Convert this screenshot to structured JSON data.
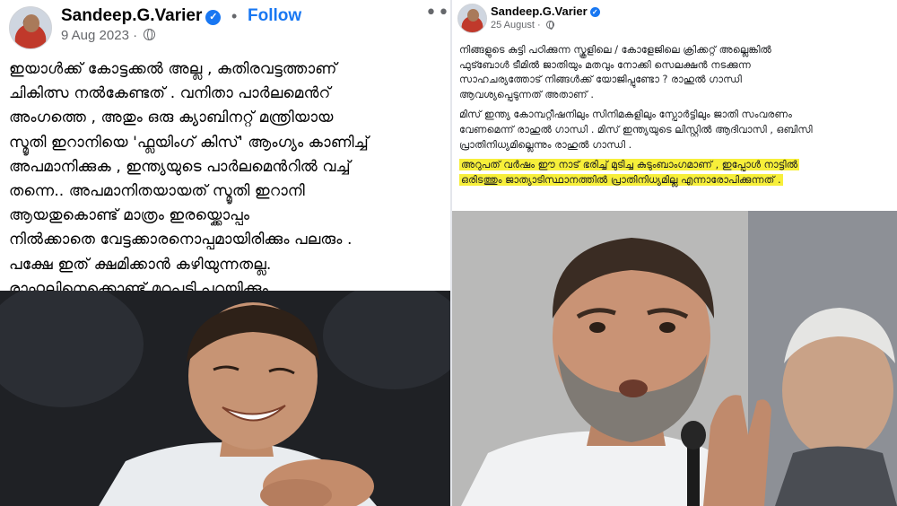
{
  "left_post": {
    "author": "Sandeep.G.Varier",
    "follow_label": "Follow",
    "separator": "•",
    "date": "9 Aug 2023",
    "date_separator": "·",
    "more_icon": "more-horizontal-icon",
    "text_lines": [
      "ഇയാൾക്ക് കോട്ടക്കൽ അല്ല , കുതിരവട്ടത്താണ്",
      "ചികിത്സ നൽകേണ്ടത് .  വനിതാ പാർലമെൻറ്",
      "അംഗത്തെ , അതും ഒരു ക്യാബിനറ്റ് മന്ത്രിയായ",
      "സ്മൃതി ഇറാനിയെ 'ഫ്ലയിംഗ് കിസ്' ആംഗ്യം കാണിച്ച്",
      "അപമാനിക്കുക , ഇന്ത്യയുടെ പാർലമെൻറിൽ വച്ച്",
      "തന്നെ..  അപമാനിതയായത് സ്മൃതി ഇറാനി",
      "ആയതുകൊണ്ട് മാത്രം ഇരയ്ക്കൊപ്പം",
      "നിൽക്കാതെ വേട്ടക്കാരനൊപ്പമായിരിക്കും പലരും .",
      "പക്ഷേ ഇത് ക്ഷമിക്കാൻ കഴിയുന്നതല്ല.",
      "രാഹുലിനെക്കൊണ്ട് മറുപടി പറയിക്കും ."
    ]
  },
  "right_post": {
    "author": "Sandeep.G.Varier",
    "date": "25 August",
    "date_separator": "·",
    "para1_lines": [
      "നിങ്ങളുടെ കുട്ടി പഠിക്കുന്ന സ്കൂളിലെ / കോളേജിലെ  ക്രിക്കറ്റ് അല്ലെങ്കിൽ",
      "ഫുട്ബോൾ ടീമിൽ ജാതിയും മതവും നോക്കി സെലക്ഷൻ നടക്കുന്ന",
      "സാഹചര്യത്തോട് നിങ്ങൾക്ക് യോജിപ്പുണ്ടോ ? രാഹുൽ ഗാന്ധി",
      "ആവശ്യപ്പെടുന്നത് അതാണ് ."
    ],
    "para2_lines": [
      "മിസ് ഇന്ത്യ കോമ്പറ്റീഷനിലും സിനിമകളിലും സ്പോർട്ടിലും ജാതി സംവരണം",
      "വേണമെന്ന് രാഹുൽ ഗാന്ധി . മിസ് ഇന്ത്യയുടെ ലിസ്റ്റിൽ ആദിവാസി , ഒബിസി",
      "പ്രാതിനിധ്യമില്ലെന്നും രാഹുൽ ഗാന്ധി ."
    ],
    "para3_lines": [
      "അറുപത് വർഷം ഈ നാട് ഭരിച്ച് മുടിച്ച കുടുംബാംഗമാണ് , ഇപ്പോൾ നാട്ടിൽ",
      "ഒരിടത്തും ജാത്യാടിസ്ഥാനത്തിൽ പ്രാതിനിധ്യമില്ല എന്നാരോപിക്കുന്നത് ."
    ],
    "highlight_color": "#f7ef3a"
  },
  "colors": {
    "link_blue": "#1877f2",
    "verified_blue": "#1877f2",
    "meta_gray": "#65676b"
  }
}
